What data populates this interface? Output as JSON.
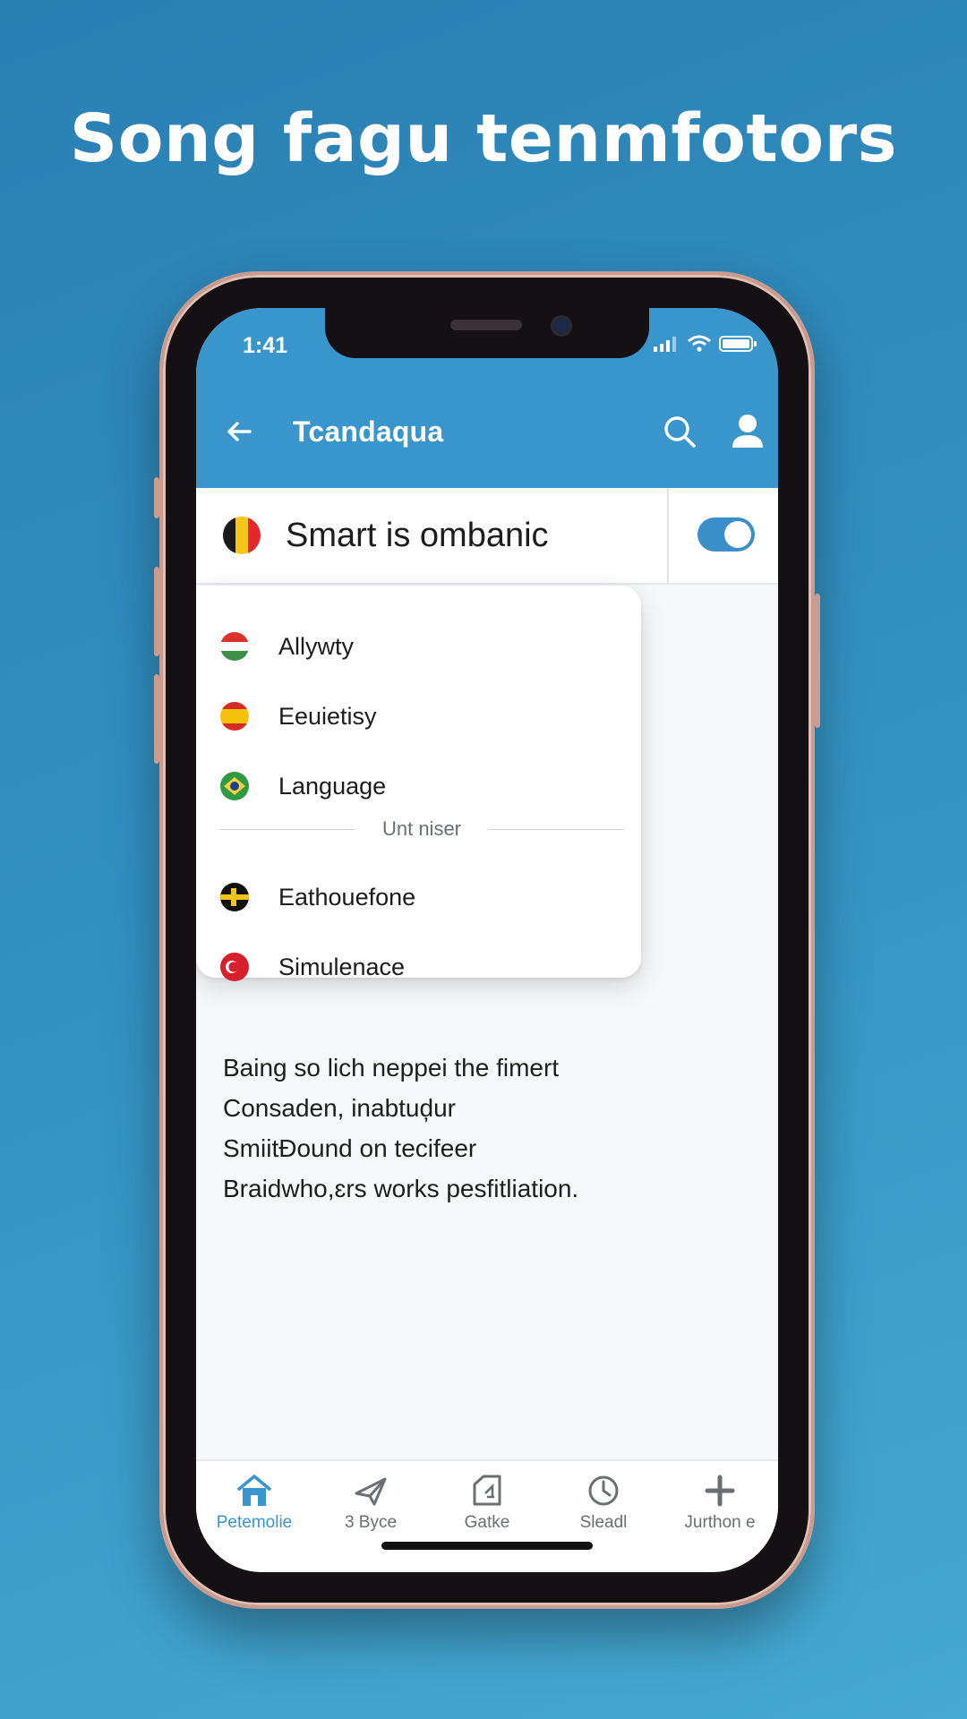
{
  "headline": "Song fagu tenmfotors",
  "status_bar": {
    "time": "1:41"
  },
  "app_bar": {
    "title": "Tcandaqua"
  },
  "language_row": {
    "text": "Smart is ombanic",
    "flag_colors": [
      "#1a1a1a",
      "#f5c518",
      "#e2282e"
    ],
    "toggle_on": true
  },
  "dropdown": {
    "items": [
      {
        "label": "Allywty",
        "flag_colors": [
          "#d9342b",
          "#ffffff",
          "#3e8f48"
        ]
      },
      {
        "label": "Eeuietisy",
        "flag_colors": [
          "#d62b22",
          "#f4c20d",
          "#d62b22"
        ]
      },
      {
        "label": "Language",
        "flag_colors": [
          "#2f9a41",
          "#f6d33c",
          "#2f9a41"
        ]
      }
    ],
    "separator_label": "Unt niser",
    "items_after": [
      {
        "label": "Eathouefone",
        "flag_colors": [
          "#111111",
          "#f0c419",
          "#111111"
        ]
      },
      {
        "label": "Simulenace",
        "flag_colors": [
          "#d8202c",
          "#d8202c",
          "#d8202c"
        ]
      }
    ]
  },
  "body_lines": [
    "Baing so lich neppei the fimert",
    "Consaden, inabtuḑur",
    "SmiitĐound on tecifeer",
    "Braidwho,ɛrs works pesfitliation."
  ],
  "bottom_nav": [
    {
      "label": "Petemolie",
      "icon": "home-icon",
      "active": true
    },
    {
      "label": "3 Byce",
      "icon": "send-icon",
      "active": false
    },
    {
      "label": "Gatke",
      "icon": "card-icon",
      "active": false
    },
    {
      "label": "Sleadl",
      "icon": "clock-icon",
      "active": false
    },
    {
      "label": "Jurthon e",
      "icon": "plus-icon",
      "active": false
    }
  ],
  "colors": {
    "accent": "#3996cd",
    "background": "#2f8cbf"
  }
}
